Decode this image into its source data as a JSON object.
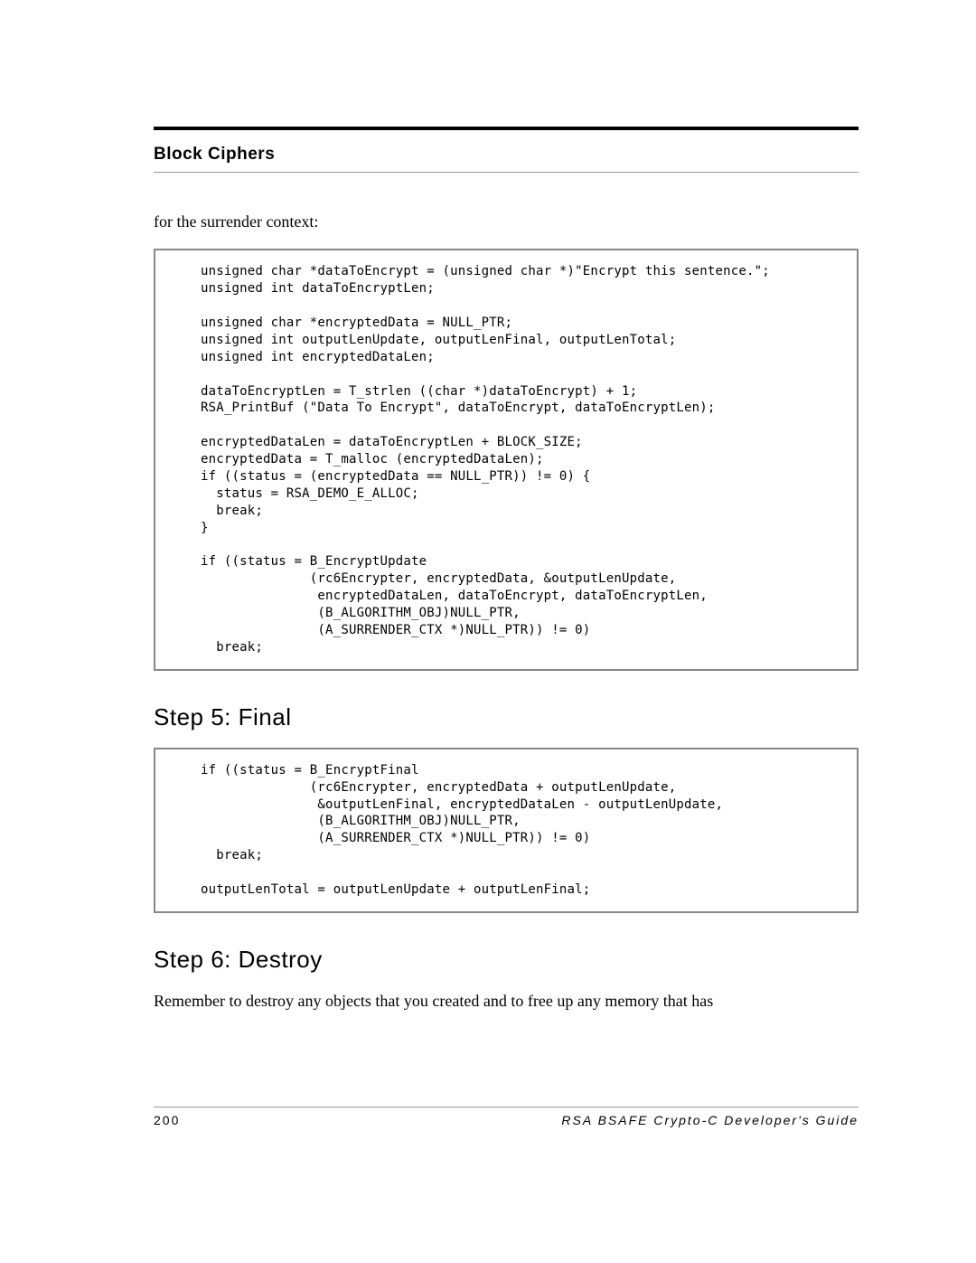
{
  "header": {
    "section": "Block Ciphers"
  },
  "intro": "for the surrender context:",
  "code1": "unsigned char *dataToEncrypt = (unsigned char *)\"Encrypt this sentence.\";\nunsigned int dataToEncryptLen;\n\nunsigned char *encryptedData = NULL_PTR;\nunsigned int outputLenUpdate, outputLenFinal, outputLenTotal;\nunsigned int encryptedDataLen;\n\ndataToEncryptLen = T_strlen ((char *)dataToEncrypt) + 1;\nRSA_PrintBuf (\"Data To Encrypt\", dataToEncrypt, dataToEncryptLen);\n\nencryptedDataLen = dataToEncryptLen + BLOCK_SIZE;\nencryptedData = T_malloc (encryptedDataLen);\nif ((status = (encryptedData == NULL_PTR)) != 0) {\n  status = RSA_DEMO_E_ALLOC;\n  break;\n}\n\nif ((status = B_EncryptUpdate\n              (rc6Encrypter, encryptedData, &outputLenUpdate,\n               encryptedDataLen, dataToEncrypt, dataToEncryptLen,\n               (B_ALGORITHM_OBJ)NULL_PTR,\n               (A_SURRENDER_CTX *)NULL_PTR)) != 0)\n  break;",
  "step5": {
    "heading": "Step 5: Final",
    "code": "if ((status = B_EncryptFinal\n              (rc6Encrypter, encryptedData + outputLenUpdate,\n               &outputLenFinal, encryptedDataLen - outputLenUpdate,\n               (B_ALGORITHM_OBJ)NULL_PTR,\n               (A_SURRENDER_CTX *)NULL_PTR)) != 0)\n  break;\n\noutputLenTotal = outputLenUpdate + outputLenFinal;"
  },
  "step6": {
    "heading": "Step 6: Destroy",
    "body": "Remember to destroy any objects that you created and to free up any memory that has"
  },
  "footer": {
    "page": "200",
    "title": "RSA BSAFE Crypto-C Developer's Guide"
  }
}
